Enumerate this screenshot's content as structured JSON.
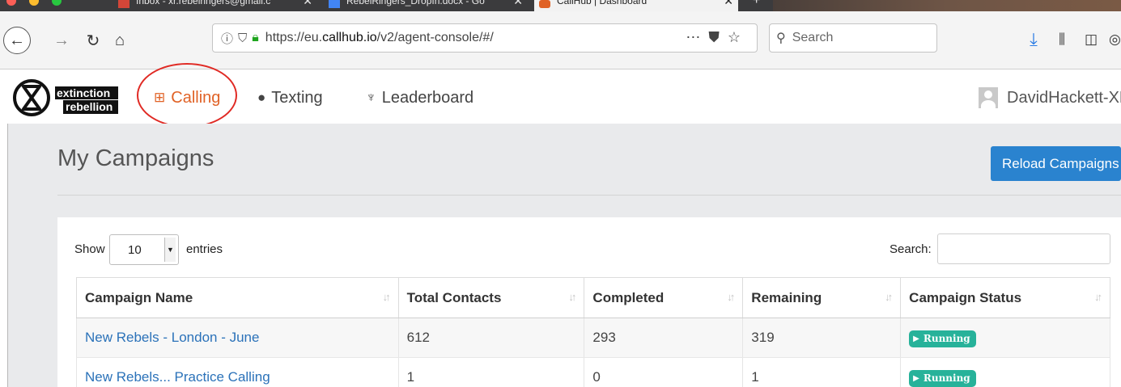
{
  "browser": {
    "tabs": [
      {
        "label": "Inbox - xr.rebelringers@gmail.c",
        "active": false
      },
      {
        "label": "RebelRingers_DropIn.docx - Go",
        "active": false
      },
      {
        "label": "CallHub | Dashboard",
        "active": true
      }
    ],
    "url_prefix": "https://eu.",
    "url_domain": "callhub.io",
    "url_suffix": "/v2/agent-console/#/",
    "search_placeholder": "Search"
  },
  "app": {
    "logo_text_line1": "extinction",
    "logo_text_line2": "rebellion",
    "nav": [
      {
        "label": "Calling",
        "icon": "table-grid-icon",
        "active": true
      },
      {
        "label": "Texting",
        "icon": "chat-bubbles-icon",
        "active": false
      },
      {
        "label": "Leaderboard",
        "icon": "trophy-icon",
        "active": false
      }
    ],
    "user_name": "DavidHackett-XR",
    "accent_color": "#e06226",
    "highlight_color": "#e02a24"
  },
  "page": {
    "title": "My Campaigns",
    "reload_label": "Reload Campaigns",
    "button_color": "#2a83cf"
  },
  "table": {
    "show_label": "Show",
    "entries_value": "10",
    "entries_label": "entries",
    "search_label": "Search:",
    "columns": [
      "Campaign Name",
      "Total Contacts",
      "Completed",
      "Remaining",
      "Campaign Status"
    ],
    "rows": [
      {
        "name": "New Rebels - London - June",
        "total": "612",
        "completed": "293",
        "remaining": "319",
        "status": "Running"
      },
      {
        "name": "New Rebels... Practice Calling",
        "total": "1",
        "completed": "0",
        "remaining": "1",
        "status": "Running"
      }
    ],
    "status_color": "#27b29a"
  }
}
